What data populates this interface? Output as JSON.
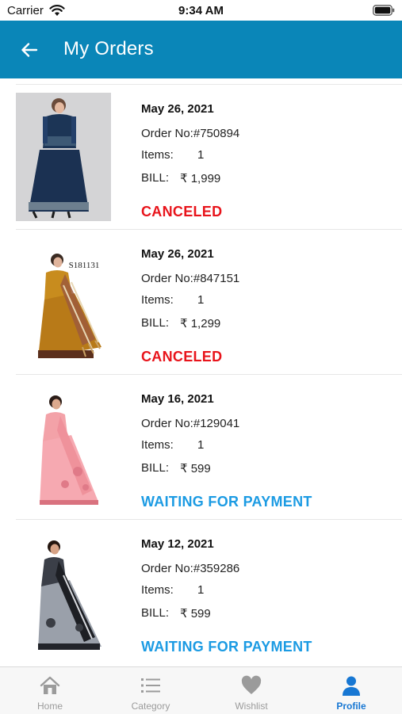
{
  "status_bar": {
    "carrier": "Carrier",
    "time": "9:34 AM"
  },
  "header": {
    "title": "My Orders"
  },
  "labels": {
    "items": "Items:",
    "bill": "BILL:"
  },
  "orders": [
    {
      "date": "May 26, 2021",
      "order_no": "Order No:#750894",
      "items": "1",
      "bill": "₹ 1,999",
      "status": "CANCELED",
      "image": "dark-blue-kurti-skirt-set-photo"
    },
    {
      "date": "May 26, 2021",
      "order_no": "Order No:#847151",
      "items": "1",
      "bill": "₹ 1,299",
      "status": "CANCELED",
      "image": "mustard-printed-saree-photo",
      "image_text": "S181131"
    },
    {
      "date": "May 16, 2021",
      "order_no": "Order No:#129041",
      "items": "1",
      "bill": "₹ 599",
      "status": "WAITING FOR PAYMENT",
      "image": "pink-embroidered-saree-photo"
    },
    {
      "date": "May 12, 2021",
      "order_no": "Order No:#359286",
      "items": "1",
      "bill": "₹ 599",
      "status": "WAITING FOR PAYMENT",
      "image": "grey-black-saree-photo"
    }
  ],
  "tabs": [
    {
      "label": "Home",
      "icon": "home-icon"
    },
    {
      "label": "Category",
      "icon": "list-icon"
    },
    {
      "label": "Wishlist",
      "icon": "heart-icon"
    },
    {
      "label": "Profile",
      "icon": "user-icon",
      "active": true
    }
  ],
  "colors": {
    "app_bar": "#0a86b8",
    "canceled": "#e8141b",
    "waiting": "#1c9be3",
    "tab_active": "#1777d3",
    "tab_inactive": "#9b9b9b"
  }
}
